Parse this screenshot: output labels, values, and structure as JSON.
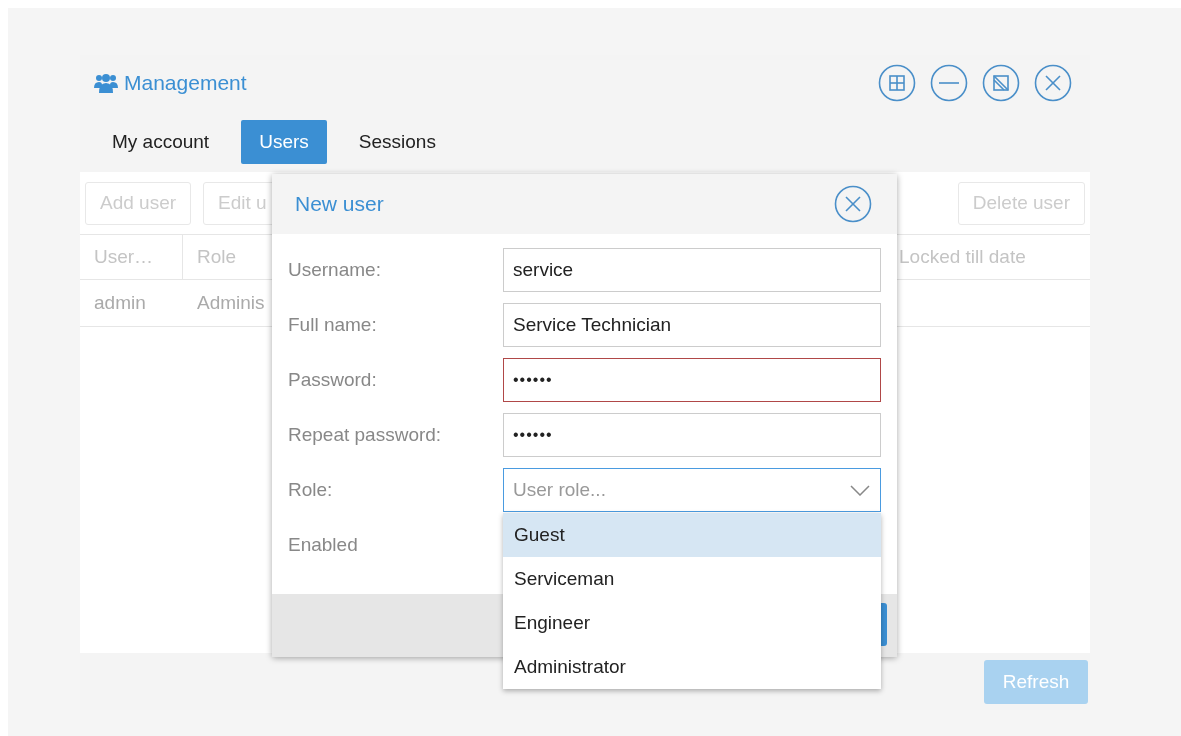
{
  "window": {
    "title": "Management"
  },
  "tabs": [
    {
      "label": "My account",
      "selected": false
    },
    {
      "label": "Users",
      "selected": true
    },
    {
      "label": "Sessions",
      "selected": false
    }
  ],
  "toolbar": {
    "buttons": [
      {
        "label": "Add user",
        "disabled": true
      },
      {
        "label": "Edit u",
        "disabled": true
      },
      {
        "label": "Delete user",
        "disabled": true
      }
    ]
  },
  "table": {
    "columns": [
      "User…",
      "Role",
      "Locked till date"
    ],
    "rows": [
      {
        "cells": [
          "admin",
          "Adminis"
        ]
      }
    ]
  },
  "dialog": {
    "title": "New user",
    "fields": [
      {
        "label": "Username:",
        "kind": "text",
        "value": "service",
        "invalid": false
      },
      {
        "label": "Full name:",
        "kind": "text",
        "value": "Service Technician",
        "invalid": false
      },
      {
        "label": "Password:",
        "kind": "password",
        "value": "••••••",
        "invalid": true
      },
      {
        "label": "Repeat password:",
        "kind": "password",
        "value": "••••••",
        "invalid": false
      },
      {
        "label": "Role:",
        "kind": "select",
        "placeholder": "User role...",
        "expanded": true
      },
      {
        "label": "Enabled",
        "kind": "label"
      }
    ],
    "role_options": [
      {
        "label": "Guest",
        "selected": true
      },
      {
        "label": "Serviceman",
        "selected": false
      },
      {
        "label": "Engineer",
        "selected": false
      },
      {
        "label": "Administrator",
        "selected": false
      }
    ]
  },
  "refresh_button": {
    "label": "Refresh",
    "disabled": true
  }
}
